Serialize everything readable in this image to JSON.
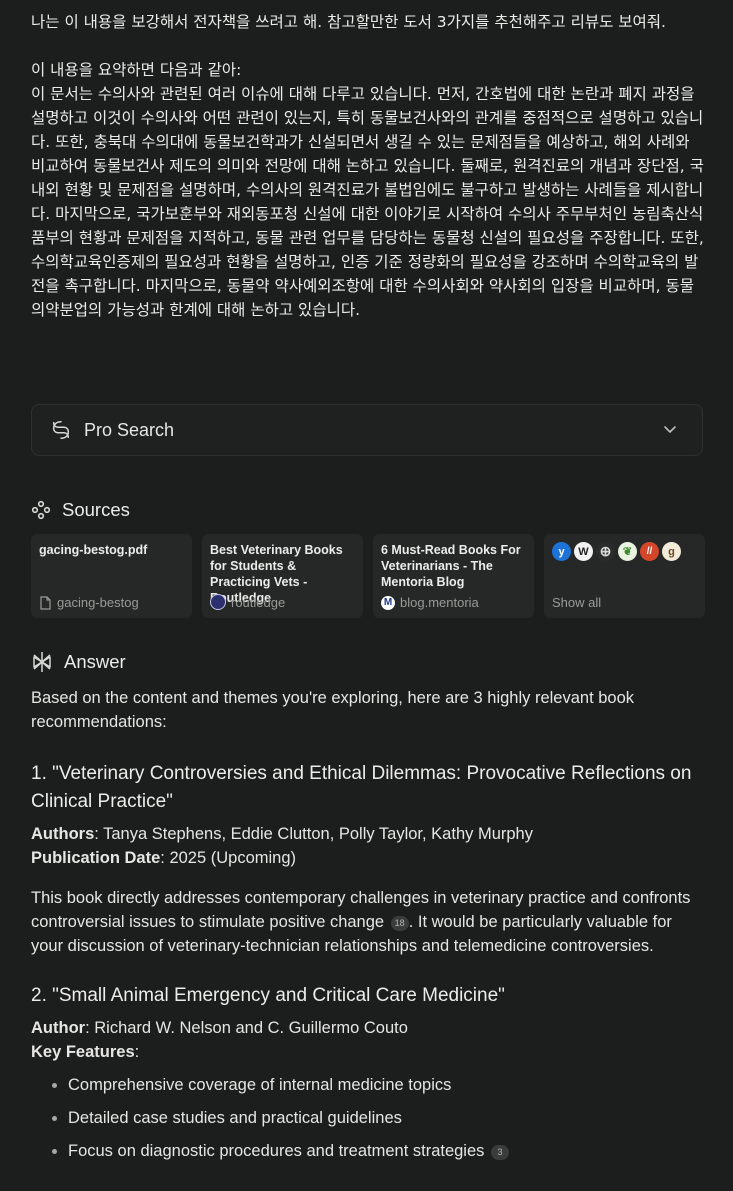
{
  "query": {
    "line1": "나는 이 내용을 보강해서 전자책을 쓰려고 해. 참고할만한 도서 3가지를 추천해주고 리뷰도 보여줘.",
    "line2": "이 내용을 요약하면 다음과 같아:",
    "summary": "이 문서는 수의사와 관련된 여러 이슈에 대해 다루고 있습니다. 먼저, 간호법에 대한 논란과 폐지 과정을 설명하고 이것이 수의사와 어떤 관련이 있는지, 특히 동물보건사와의 관계를 중점적으로 설명하고 있습니다. 또한, 충북대 수의대에 동물보건학과가 신설되면서 생길 수 있는 문제점들을 예상하고, 해외 사례와 비교하여 동물보건사 제도의 의미와 전망에 대해 논하고 있습니다. 둘째로, 원격진료의 개념과 장단점, 국내외 현황 및 문제점을 설명하며, 수의사의 원격진료가 불법임에도 불구하고 발생하는 사례들을 제시합니다. 마지막으로, 국가보훈부와 재외동포청 신설에 대한 이야기로 시작하여 수의사 주무부처인 농림축산식품부의 현황과 문제점을 지적하고, 동물 관련 업무를 담당하는 동물청 신설의 필요성을 주장합니다. 또한, 수의학교육인증제의 필요성과 현황을 설명하고, 인증 기준 정량화의 필요성을 강조하며 수의학교육의 발전을 촉구합니다. 마지막으로, 동물약 약사예외조항에 대한 수의사회와 약사회의 입장을 비교하며, 동물 의약분업의 가능성과 한계에 대해 논하고 있습니다."
  },
  "pro_search": {
    "label": "Pro Search"
  },
  "sources": {
    "title": "Sources",
    "cards": [
      {
        "title": "gacing-bestog.pdf",
        "source": "gacing-bestog"
      },
      {
        "title": "Best Veterinary Books for Students & Practicing Vets - Routledge",
        "source": "routledge"
      },
      {
        "title": "6 Must-Read Books For Veterinarians - The Mentoria Blog",
        "source": "blog.mentoria"
      }
    ],
    "show_all": "Show all",
    "favicons": [
      "y",
      "W",
      "⊕",
      "❦",
      "//",
      "g"
    ]
  },
  "answer": {
    "title": "Answer",
    "intro": "Based on the content and themes you're exploring, here are 3 highly relevant book recommendations:",
    "book1": {
      "heading": "1. \"Veterinary Controversies and Ethical Dilemmas: Provocative Reflections on Clinical Practice\"",
      "authors_label": "Authors",
      "authors": ": Tanya Stephens, Eddie Clutton, Polly Taylor, Kathy Murphy",
      "date_label": "Publication Date",
      "date": ": 2025 (Upcoming)",
      "desc_a": "This book directly addresses contemporary challenges in veterinary practice and confronts controversial issues to stimulate positive change ",
      "cite": "18",
      "desc_b": ". It would be particularly valuable for your discussion of veterinary-technician relationships and telemedicine controversies."
    },
    "book2": {
      "heading": "2. \"Small Animal Emergency and Critical Care Medicine\"",
      "author_label": "Author",
      "author": ": Richard W. Nelson and C. Guillermo Couto",
      "features_label": "Key Features",
      "features_colon": ":",
      "features": [
        "Comprehensive coverage of internal medicine topics",
        "Detailed case studies and practical guidelines",
        "Focus on diagnostic procedures and treatment strategies"
      ],
      "cite": "3"
    }
  },
  "colors": {
    "background": "#1c1d1d",
    "text": "#e8e8e6",
    "muted": "#9a9b98",
    "card": "#262828"
  }
}
